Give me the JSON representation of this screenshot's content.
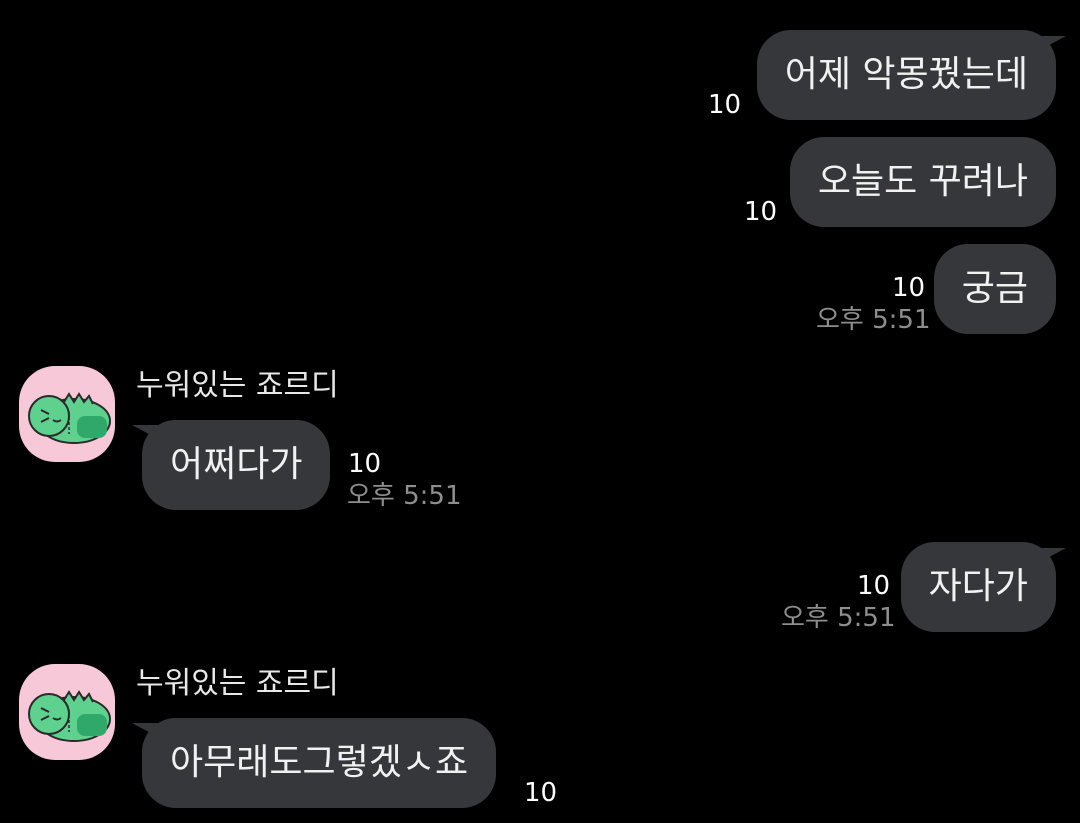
{
  "colors": {
    "background": "#000000",
    "bubble": "#36373b",
    "avatar_bg": "#f7c9d8",
    "time_text": "#8e8e8e"
  },
  "messages": [
    {
      "from": "me",
      "text": "어제 악몽꿨는데",
      "unread": "10"
    },
    {
      "from": "me",
      "text": "오늘도 꾸려나",
      "unread": "10"
    },
    {
      "from": "me",
      "text": "궁금",
      "unread": "10",
      "time": "오후 5:51"
    },
    {
      "from": "other",
      "sender": "누워있는 죠르디",
      "avatar": "jordy-lying-icon",
      "text": "어쩌다가",
      "unread": "10",
      "time": "오후 5:51"
    },
    {
      "from": "me",
      "text": "자다가",
      "unread": "10",
      "time": "오후 5:51"
    },
    {
      "from": "other",
      "sender": "누워있는 죠르디",
      "avatar": "jordy-lying-icon",
      "text": "아무래도그렇겠ㅅ죠",
      "unread": "10"
    }
  ]
}
